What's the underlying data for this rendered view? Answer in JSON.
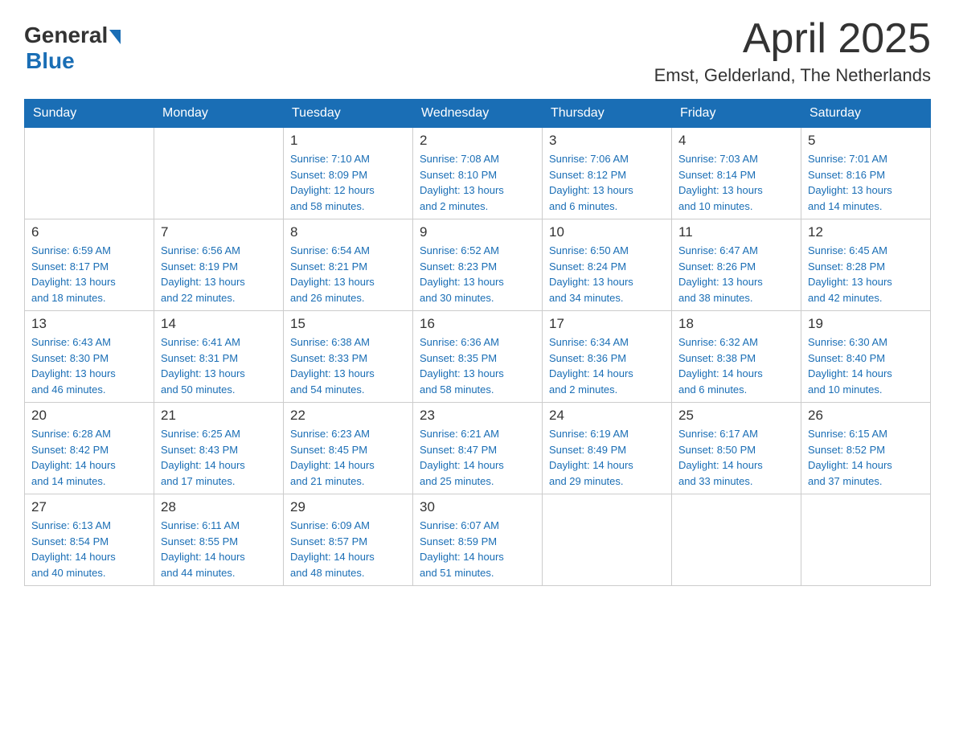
{
  "header": {
    "title": "April 2025",
    "subtitle": "Emst, Gelderland, The Netherlands"
  },
  "logo": {
    "text_general": "General",
    "text_blue": "Blue"
  },
  "calendar": {
    "days_of_week": [
      "Sunday",
      "Monday",
      "Tuesday",
      "Wednesday",
      "Thursday",
      "Friday",
      "Saturday"
    ],
    "weeks": [
      [
        {
          "day": "",
          "info": ""
        },
        {
          "day": "",
          "info": ""
        },
        {
          "day": "1",
          "info": "Sunrise: 7:10 AM\nSunset: 8:09 PM\nDaylight: 12 hours\nand 58 minutes."
        },
        {
          "day": "2",
          "info": "Sunrise: 7:08 AM\nSunset: 8:10 PM\nDaylight: 13 hours\nand 2 minutes."
        },
        {
          "day": "3",
          "info": "Sunrise: 7:06 AM\nSunset: 8:12 PM\nDaylight: 13 hours\nand 6 minutes."
        },
        {
          "day": "4",
          "info": "Sunrise: 7:03 AM\nSunset: 8:14 PM\nDaylight: 13 hours\nand 10 minutes."
        },
        {
          "day": "5",
          "info": "Sunrise: 7:01 AM\nSunset: 8:16 PM\nDaylight: 13 hours\nand 14 minutes."
        }
      ],
      [
        {
          "day": "6",
          "info": "Sunrise: 6:59 AM\nSunset: 8:17 PM\nDaylight: 13 hours\nand 18 minutes."
        },
        {
          "day": "7",
          "info": "Sunrise: 6:56 AM\nSunset: 8:19 PM\nDaylight: 13 hours\nand 22 minutes."
        },
        {
          "day": "8",
          "info": "Sunrise: 6:54 AM\nSunset: 8:21 PM\nDaylight: 13 hours\nand 26 minutes."
        },
        {
          "day": "9",
          "info": "Sunrise: 6:52 AM\nSunset: 8:23 PM\nDaylight: 13 hours\nand 30 minutes."
        },
        {
          "day": "10",
          "info": "Sunrise: 6:50 AM\nSunset: 8:24 PM\nDaylight: 13 hours\nand 34 minutes."
        },
        {
          "day": "11",
          "info": "Sunrise: 6:47 AM\nSunset: 8:26 PM\nDaylight: 13 hours\nand 38 minutes."
        },
        {
          "day": "12",
          "info": "Sunrise: 6:45 AM\nSunset: 8:28 PM\nDaylight: 13 hours\nand 42 minutes."
        }
      ],
      [
        {
          "day": "13",
          "info": "Sunrise: 6:43 AM\nSunset: 8:30 PM\nDaylight: 13 hours\nand 46 minutes."
        },
        {
          "day": "14",
          "info": "Sunrise: 6:41 AM\nSunset: 8:31 PM\nDaylight: 13 hours\nand 50 minutes."
        },
        {
          "day": "15",
          "info": "Sunrise: 6:38 AM\nSunset: 8:33 PM\nDaylight: 13 hours\nand 54 minutes."
        },
        {
          "day": "16",
          "info": "Sunrise: 6:36 AM\nSunset: 8:35 PM\nDaylight: 13 hours\nand 58 minutes."
        },
        {
          "day": "17",
          "info": "Sunrise: 6:34 AM\nSunset: 8:36 PM\nDaylight: 14 hours\nand 2 minutes."
        },
        {
          "day": "18",
          "info": "Sunrise: 6:32 AM\nSunset: 8:38 PM\nDaylight: 14 hours\nand 6 minutes."
        },
        {
          "day": "19",
          "info": "Sunrise: 6:30 AM\nSunset: 8:40 PM\nDaylight: 14 hours\nand 10 minutes."
        }
      ],
      [
        {
          "day": "20",
          "info": "Sunrise: 6:28 AM\nSunset: 8:42 PM\nDaylight: 14 hours\nand 14 minutes."
        },
        {
          "day": "21",
          "info": "Sunrise: 6:25 AM\nSunset: 8:43 PM\nDaylight: 14 hours\nand 17 minutes."
        },
        {
          "day": "22",
          "info": "Sunrise: 6:23 AM\nSunset: 8:45 PM\nDaylight: 14 hours\nand 21 minutes."
        },
        {
          "day": "23",
          "info": "Sunrise: 6:21 AM\nSunset: 8:47 PM\nDaylight: 14 hours\nand 25 minutes."
        },
        {
          "day": "24",
          "info": "Sunrise: 6:19 AM\nSunset: 8:49 PM\nDaylight: 14 hours\nand 29 minutes."
        },
        {
          "day": "25",
          "info": "Sunrise: 6:17 AM\nSunset: 8:50 PM\nDaylight: 14 hours\nand 33 minutes."
        },
        {
          "day": "26",
          "info": "Sunrise: 6:15 AM\nSunset: 8:52 PM\nDaylight: 14 hours\nand 37 minutes."
        }
      ],
      [
        {
          "day": "27",
          "info": "Sunrise: 6:13 AM\nSunset: 8:54 PM\nDaylight: 14 hours\nand 40 minutes."
        },
        {
          "day": "28",
          "info": "Sunrise: 6:11 AM\nSunset: 8:55 PM\nDaylight: 14 hours\nand 44 minutes."
        },
        {
          "day": "29",
          "info": "Sunrise: 6:09 AM\nSunset: 8:57 PM\nDaylight: 14 hours\nand 48 minutes."
        },
        {
          "day": "30",
          "info": "Sunrise: 6:07 AM\nSunset: 8:59 PM\nDaylight: 14 hours\nand 51 minutes."
        },
        {
          "day": "",
          "info": ""
        },
        {
          "day": "",
          "info": ""
        },
        {
          "day": "",
          "info": ""
        }
      ]
    ]
  }
}
